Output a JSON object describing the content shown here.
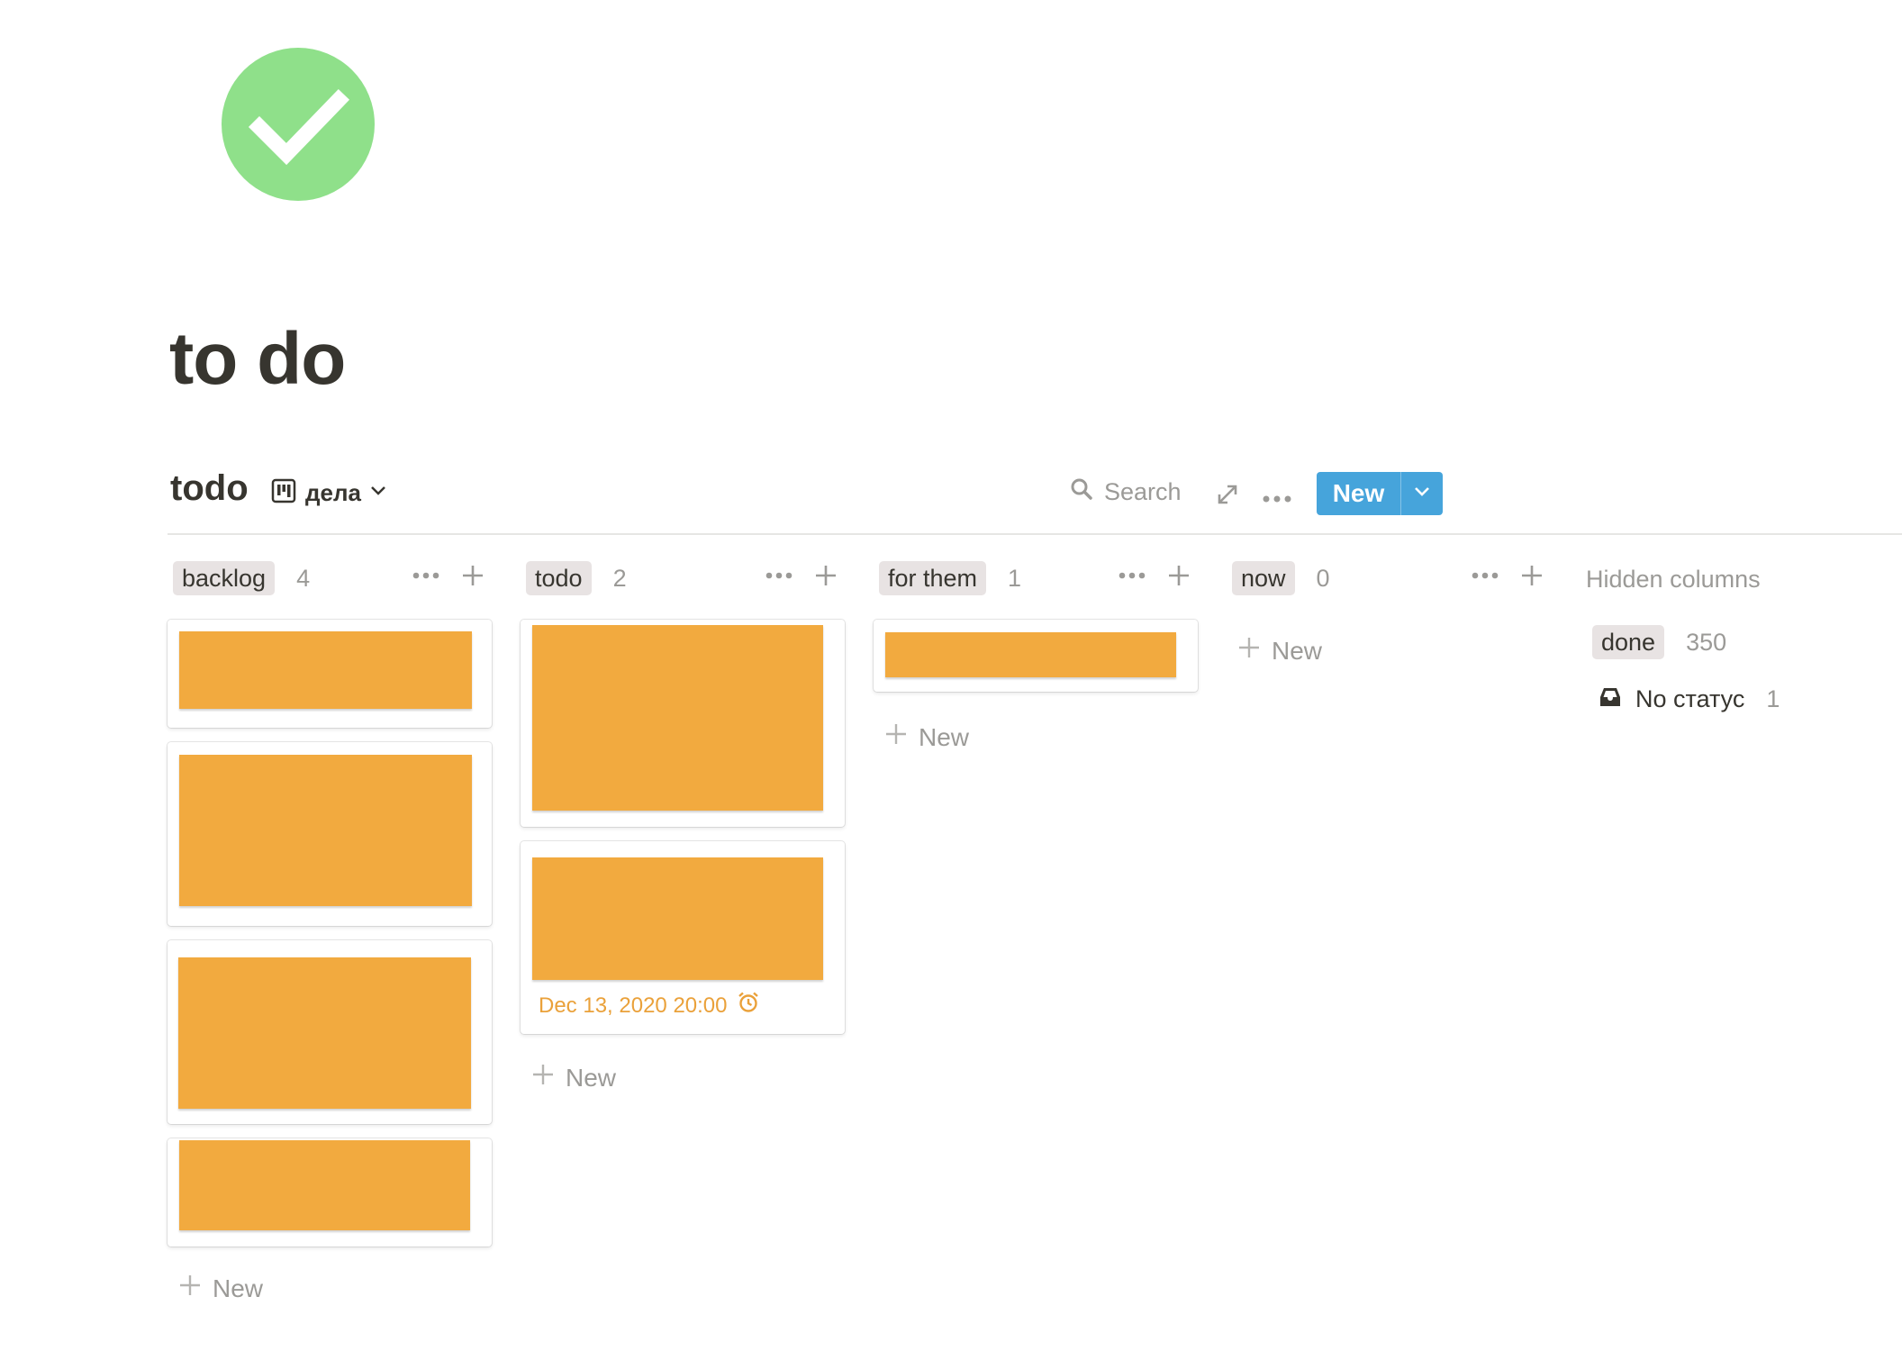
{
  "page": {
    "title": "to do",
    "icon": "check-circle-icon",
    "icon_color": "#8fe08a"
  },
  "database": {
    "title": "todo",
    "view_icon": "board-view-icon",
    "view_name": "дела",
    "search_label": "Search",
    "new_label": "New",
    "accent": "#46a4db"
  },
  "columns": [
    {
      "name": "backlog",
      "count": "4",
      "new_label": "New"
    },
    {
      "name": "todo",
      "count": "2",
      "new_label": "New"
    },
    {
      "name": "for them",
      "count": "1",
      "new_label": "New"
    },
    {
      "name": "now",
      "count": "0",
      "new_label": "New"
    }
  ],
  "cards": {
    "todo_second_date": "Dec 13, 2020 20:00",
    "cover_color": "#f2aa3f"
  },
  "hidden": {
    "title": "Hidden columns",
    "items": [
      {
        "name": "done",
        "count": "350"
      },
      {
        "name": "No статус",
        "count": "1"
      }
    ]
  }
}
